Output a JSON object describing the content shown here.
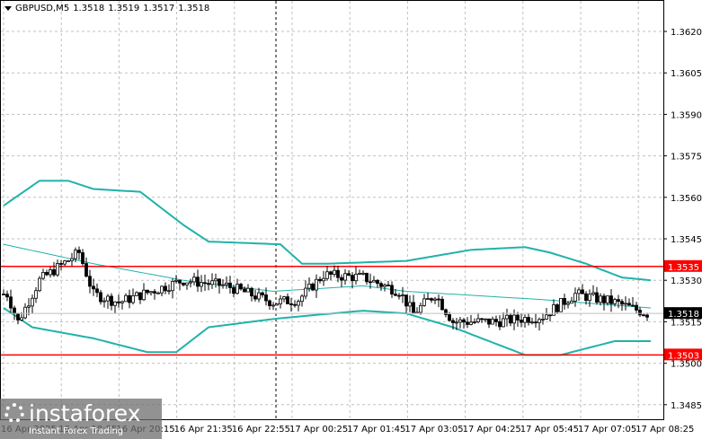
{
  "header": {
    "symbol": "GBPUSD,M5",
    "open": "1.3518",
    "high": "1.3519",
    "low": "1.3517",
    "close": "1.3518"
  },
  "logo": {
    "name": "instaforex",
    "tagline": "Instant Forex Trading"
  },
  "chart_data": {
    "type": "candlestick",
    "title": "GBPUSD,M5",
    "ylim": [
      1.3482,
      1.363
    ],
    "y_ticks": [
      "1.3620",
      "1.3605",
      "1.3590",
      "1.3575",
      "1.3560",
      "1.3545",
      "1.3530",
      "1.3515",
      "1.3500",
      "1.3485"
    ],
    "x_ticks": [
      "16 Apr 2025",
      "16 Apr 18:55",
      "16 Apr 20:15",
      "16 Apr 21:35",
      "16 Apr 22:55",
      "17 Apr 00:25",
      "17 Apr 01:45",
      "17 Apr 03:05",
      "17 Apr 04:25",
      "17 Apr 05:45",
      "17 Apr 07:05",
      "17 Apr 08:25"
    ],
    "bars": 180,
    "price_path": [
      [
        1,
        1.3525
      ],
      [
        4,
        1.3515
      ],
      [
        10,
        1.353
      ],
      [
        21,
        1.354
      ],
      [
        25,
        1.3525
      ],
      [
        32,
        1.3522
      ],
      [
        50,
        1.353
      ],
      [
        62,
        1.3528
      ],
      [
        75,
        1.3522
      ],
      [
        82,
        1.3523
      ],
      [
        89,
        1.3532
      ],
      [
        100,
        1.3531
      ],
      [
        110,
        1.3526
      ],
      [
        114,
        1.3518
      ],
      [
        120,
        1.3525
      ],
      [
        125,
        1.3515
      ],
      [
        137,
        1.3515
      ],
      [
        150,
        1.3517
      ],
      [
        159,
        1.3525
      ],
      [
        170,
        1.3522
      ],
      [
        179,
        1.3518
      ]
    ],
    "bollinger_upper": [
      [
        0,
        1.3557
      ],
      [
        10,
        1.3566
      ],
      [
        18,
        1.3566
      ],
      [
        25,
        1.3563
      ],
      [
        38,
        1.3562
      ],
      [
        50,
        1.355
      ],
      [
        57,
        1.3544
      ],
      [
        77,
        1.3543
      ],
      [
        83,
        1.3536
      ],
      [
        90,
        1.3536
      ],
      [
        112,
        1.3537
      ],
      [
        130,
        1.3541
      ],
      [
        145,
        1.3542
      ],
      [
        152,
        1.354
      ],
      [
        162,
        1.3536
      ],
      [
        172,
        1.3531
      ],
      [
        180,
        1.353
      ]
    ],
    "bollinger_middle": [
      [
        0,
        1.3543
      ],
      [
        25,
        1.3536
      ],
      [
        50,
        1.353
      ],
      [
        75,
        1.3526
      ],
      [
        100,
        1.3528
      ],
      [
        112,
        1.3526
      ],
      [
        150,
        1.3523
      ],
      [
        180,
        1.352
      ]
    ],
    "bollinger_lower": [
      [
        0,
        1.352
      ],
      [
        8,
        1.3513
      ],
      [
        25,
        1.3509
      ],
      [
        40,
        1.3504
      ],
      [
        48,
        1.3504
      ],
      [
        57,
        1.3513
      ],
      [
        75,
        1.3516
      ],
      [
        83,
        1.3517
      ],
      [
        100,
        1.3519
      ],
      [
        112,
        1.3518
      ],
      [
        125,
        1.3513
      ],
      [
        145,
        1.3503
      ],
      [
        155,
        1.3503
      ],
      [
        170,
        1.3508
      ],
      [
        180,
        1.3508
      ]
    ],
    "levels": [
      {
        "price": 1.3535,
        "label": "1.3535",
        "color": "#ff0000"
      },
      {
        "price": 1.3503,
        "label": "1.3503",
        "color": "#ff0000"
      }
    ],
    "current_price": {
      "price": 1.3518,
      "label": "1.3518"
    },
    "colors": {
      "band": "#20b2aa",
      "middle": "#20b2aa",
      "candle": "#000000",
      "grid": "#c0c0c0"
    }
  }
}
